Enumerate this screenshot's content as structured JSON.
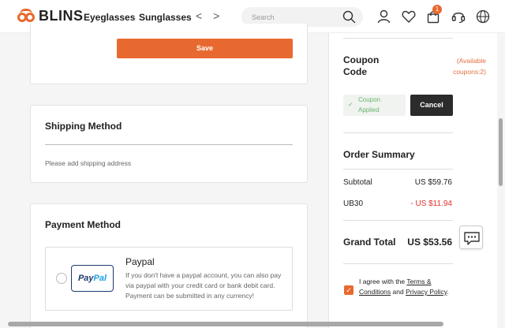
{
  "header": {
    "logo_text": "BLINS",
    "nav": [
      "Eyeglasses",
      "Sunglasses"
    ],
    "nav_arrows": "< >",
    "search_placeholder": "Search",
    "cart_count": "1",
    "icons": [
      "search-icon",
      "user-icon",
      "heart-icon",
      "cart-icon",
      "headset-icon",
      "globe-icon"
    ]
  },
  "address_card": {
    "save_label": "Save"
  },
  "shipping": {
    "title": "Shipping Method",
    "message": "Please add shipping address"
  },
  "payment": {
    "title": "Payment Method",
    "option": {
      "name": "Paypal",
      "logo_a": "Pay",
      "logo_b": "Pal",
      "description": "If you don't have a paypal account, you can also pay via paypal with your credit card or bank debit card. Payment can be submitted in any currency!"
    }
  },
  "sidebar": {
    "coupon_label": "Coupon Code",
    "coupon_available": "(Available coupons:2)",
    "coupon_applied": "Coupon Applied",
    "cancel_label": "Cancel",
    "order_summary_title": "Order Summary",
    "subtotal_label": "Subtotal",
    "subtotal_value": "US $59.76",
    "discount_label": "UB30",
    "discount_value": "- US $11.94",
    "grand_total_label": "Grand Total",
    "grand_total_value": "US $53.56",
    "agree_prefix": "I agree with the ",
    "agree_link1": "Terms & Conditions",
    "agree_and": " and ",
    "agree_link2": "Privacy Policy",
    "agree_suffix": "."
  },
  "colors": {
    "accent": "#e8692f",
    "dark_button": "#2b2b2b",
    "success": "#6db36d",
    "discount": "#e0302a"
  }
}
